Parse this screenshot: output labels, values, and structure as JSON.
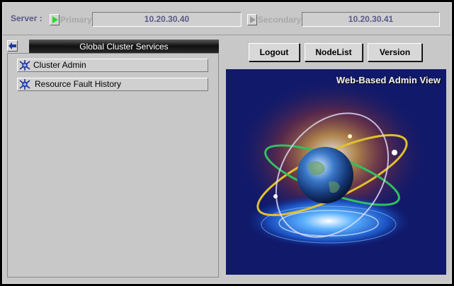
{
  "server_bar": {
    "label": "Server :",
    "primary": {
      "label": "Primary",
      "address": "10.20.30.40"
    },
    "secondary": {
      "label": "Secondary",
      "address": "10.20.30.41"
    }
  },
  "left_panel": {
    "header": "Global Cluster Services",
    "items": [
      {
        "label": "Cluster Admin",
        "icon": "cluster-admin-icon"
      },
      {
        "label": "Resource Fault History",
        "icon": "resource-fault-history-icon"
      }
    ]
  },
  "toolbar": {
    "logout_label": "Logout",
    "nodelist_label": "NodeList",
    "version_label": "Version"
  },
  "splash": {
    "title": "Web-Based Admin View"
  },
  "colors": {
    "background": "#c8c8c8",
    "server_text": "#5a5a8a",
    "primary_indicator": "#22e022",
    "splash_bg": "#10196a"
  }
}
